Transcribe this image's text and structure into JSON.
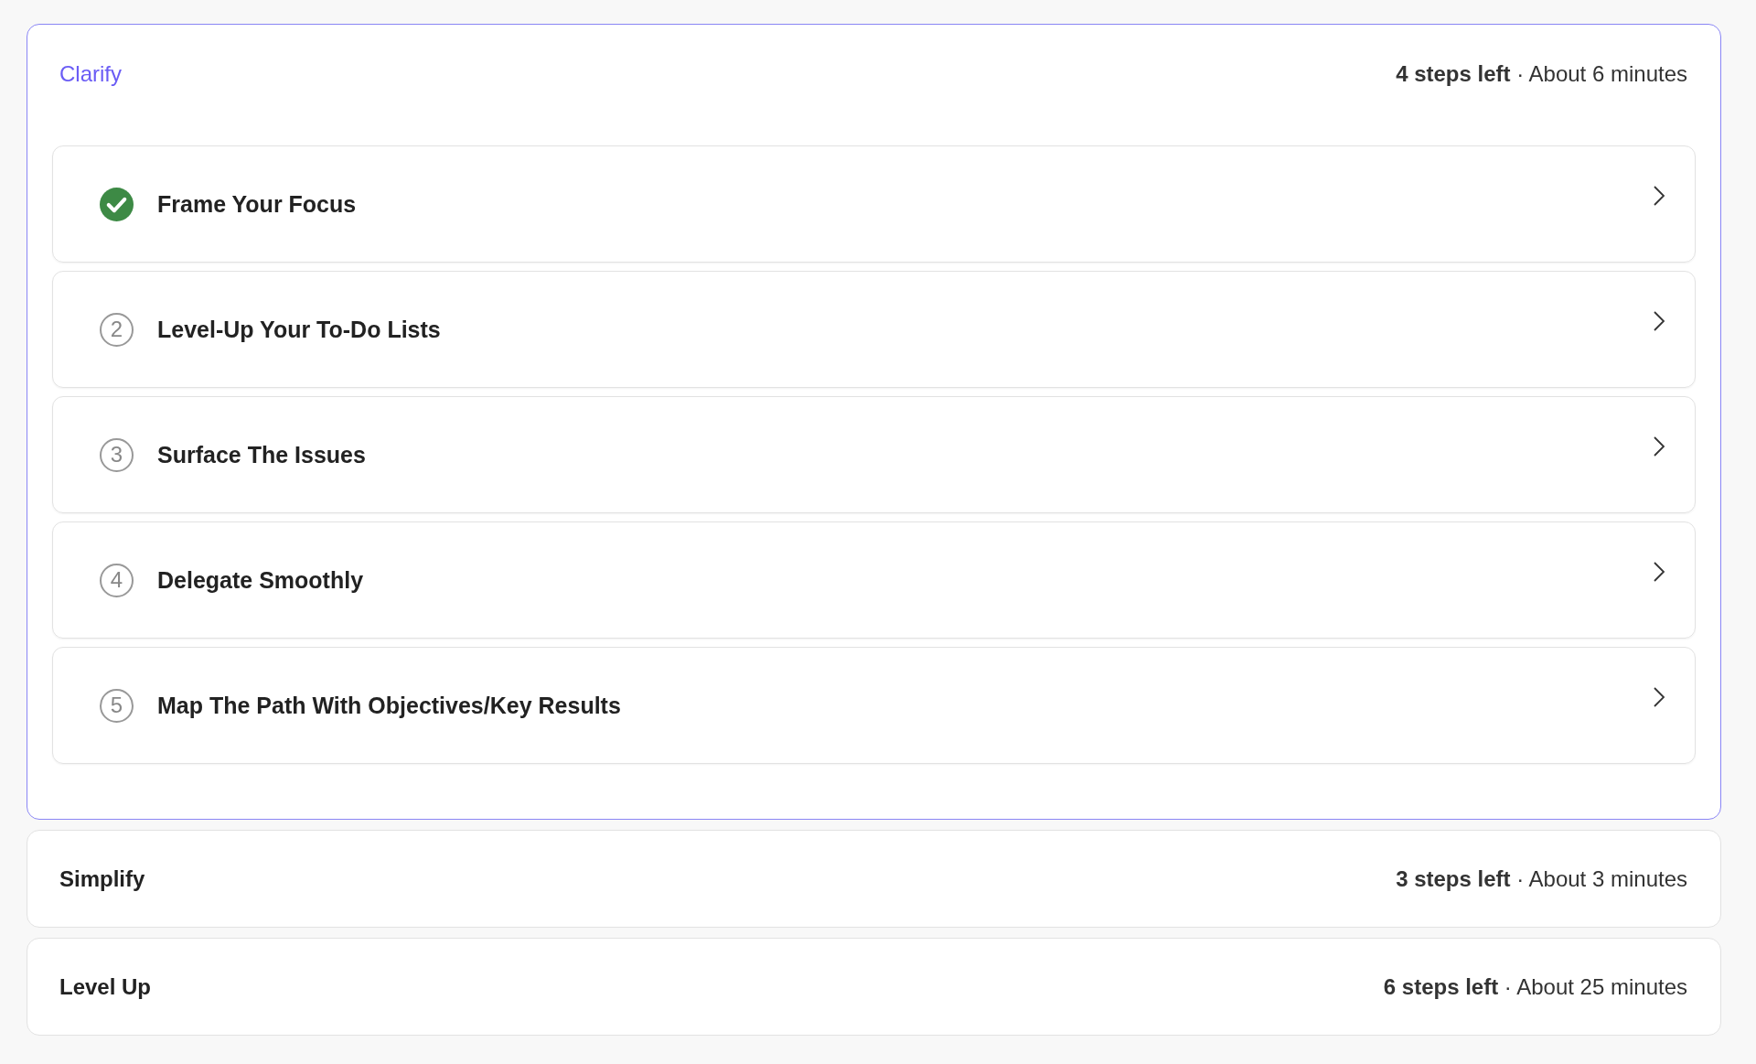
{
  "sections": [
    {
      "title": "Clarify",
      "meta": "**4 steps left** · About 6 minutes",
      "expanded": true,
      "steps": [
        {
          "label": "Frame Your Focus",
          "done": true
        },
        {
          "label": "Level-Up Your To-Do Lists",
          "done": false,
          "number": "2"
        },
        {
          "label": "Surface The Issues",
          "done": false,
          "number": "3"
        },
        {
          "label": "Delegate Smoothly",
          "done": false,
          "number": "4"
        },
        {
          "label": "Map The Path With Objectives/Key Results",
          "done": false,
          "number": "5"
        }
      ]
    },
    {
      "title": "Simplify",
      "meta": "**3 steps left** · About 3 minutes",
      "expanded": false
    },
    {
      "title": "Level Up",
      "meta": "**6 steps left** · About 25 minutes",
      "expanded": false
    }
  ]
}
